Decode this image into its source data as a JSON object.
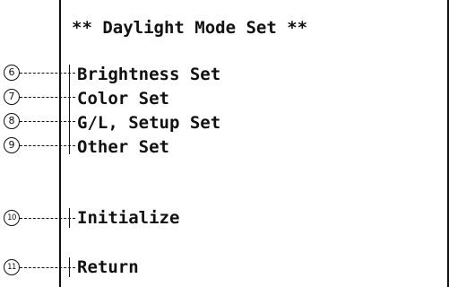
{
  "screen": {
    "title": "** Daylight Mode Set **"
  },
  "menu": {
    "items": [
      {
        "callout": "6",
        "label": "Brightness Set"
      },
      {
        "callout": "7",
        "label": "Color Set"
      },
      {
        "callout": "8",
        "label": "G/L, Setup Set"
      },
      {
        "callout": "9",
        "label": "Other Set"
      },
      {
        "callout": "10",
        "label": "Initialize"
      },
      {
        "callout": "11",
        "label": "Return"
      }
    ]
  }
}
